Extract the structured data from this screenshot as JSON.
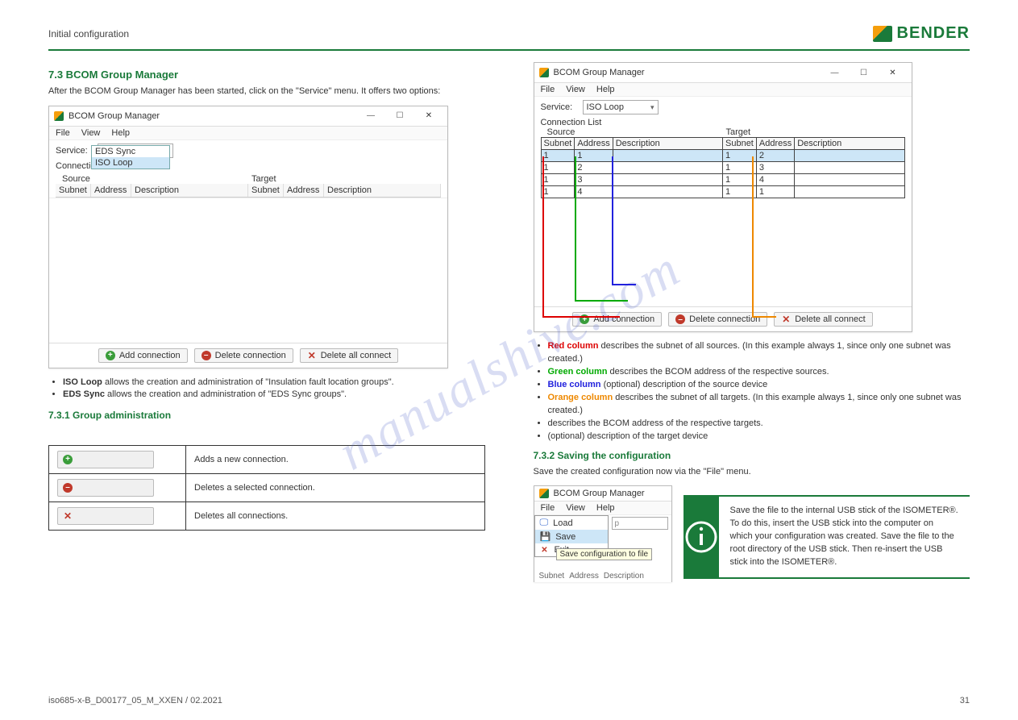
{
  "header": {
    "breadcrumb": "Initial configuration",
    "brand": "BENDER"
  },
  "section": {
    "num_title": "7.3  BCOM Group Manager",
    "intro": "After the BCOM Group Manager has been started, click on the \"Service\" menu. It offers two options:",
    "bullets_left": [
      {
        "b": "ISO Loop",
        "t": " allows the creation and administration of \"Insulation fault location groups\"."
      },
      {
        "b": "EDS Sync",
        "t": " allows the creation and administration of \"EDS Sync groups\"."
      }
    ],
    "sub_title": "7.3.1 Group administration",
    "chart_data": {
      "type": "table",
      "title": "Connection List",
      "columns": [
        "Source Subnet",
        "Source Address",
        "Source Description",
        "Target Subnet",
        "Target Address",
        "Target Description"
      ],
      "rows": [
        [
          "1",
          "1",
          "",
          "1",
          "2",
          ""
        ],
        [
          "1",
          "2",
          "",
          "1",
          "3",
          ""
        ],
        [
          "1",
          "3",
          "",
          "1",
          "4",
          ""
        ],
        [
          "1",
          "4",
          "",
          "1",
          "1",
          ""
        ]
      ]
    },
    "described_cols": [
      "describes the subnet of all sources. (In this example always 1, since only one subnet was created.)",
      "describes the BCOM address of the respective sources.",
      "(optional) description of the source device",
      "describes the subnet of all targets. (In this example always 1, since only one subnet was created.)",
      "describes the BCOM address of the respective targets.",
      "(optional) description of the target device"
    ],
    "save_title": "7.3.2 Saving the configuration",
    "save_para": "Save the created configuration now via the \"File\" menu."
  },
  "win_left": {
    "title": "BCOM Group Manager",
    "menus": [
      "File",
      "View",
      "Help"
    ],
    "service_label": "Service:",
    "service_value": "ISO Loop",
    "dropdown": [
      "EDS Sync",
      "ISO Loop"
    ],
    "conn_list": "Connection List",
    "source": "Source",
    "target": "Target",
    "cols": [
      "Subnet",
      "Address",
      "Description"
    ],
    "btns": {
      "add": "Add connection",
      "del": "Delete connection",
      "delall": "Delete all connect"
    }
  },
  "win_right": {
    "title": "BCOM Group Manager",
    "menus": [
      "File",
      "View",
      "Help"
    ],
    "service_label": "Service:",
    "service_value": "ISO Loop",
    "conn_list": "Connection List",
    "source": "Source",
    "target": "Target",
    "cols": [
      "Subnet",
      "Address",
      "Description"
    ],
    "btns": {
      "add": "Add connection",
      "del": "Delete connection",
      "delall": "Delete all connect"
    }
  },
  "legend": {
    "add": "Adds a new connection.",
    "del": "Deletes a selected connection.",
    "delall": "Deletes all connections."
  },
  "file_menu": {
    "title": "BCOM Group Manager",
    "menus": [
      "File",
      "View",
      "Help"
    ],
    "items": [
      "Load",
      "Save",
      "Exit"
    ],
    "tooltip": "Save configuration to file",
    "row_labels": [
      "Subnet",
      "Address",
      "Description"
    ],
    "placeholder": "p"
  },
  "info": {
    "text": "Save the file to the internal USB stick of the ISOMETER®. To do this, insert the USB stick into the computer on which your configuration was created. Save the file to the root directory of the USB stick. Then re-insert the USB stick into the ISOMETER®."
  },
  "footer": {
    "left": "iso685-x-B_D00177_05_M_XXEN / 02.2021",
    "right": "31"
  },
  "watermark": "manualshive.com"
}
